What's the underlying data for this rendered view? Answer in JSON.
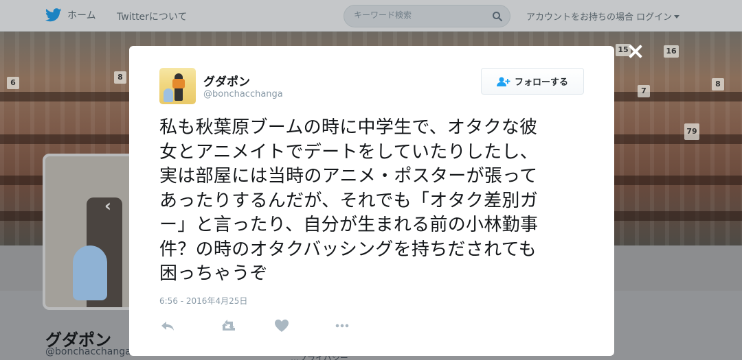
{
  "nav": {
    "home_label": "ホーム",
    "about_label": "Twitterについて",
    "search_placeholder": "キーワード検索",
    "login_label": "アカウントをお持ちの場合 ログイン"
  },
  "tweet": {
    "user_name": "グダポン",
    "user_handle": "@bonchacchanga",
    "follow_label": "フォローする",
    "text_lines": [
      "私も秋葉原ブームの時に中学生で、オタクな彼",
      "女とアニメイトでデートをしていたりしたし、",
      "実は部屋には当時のアニメ・ポスターが張って",
      "あったりするんだが、それでも「オタク差別ガ",
      "ー」と言ったり、自分が生まれる前の小林勤事",
      "件？の時のオタクバッシングを持ちだされても",
      "困っちゃうぞ"
    ],
    "timestamp": "6:56 - 2016年4月25日",
    "actions": [
      "reply-icon",
      "retweet-icon",
      "like-icon",
      "more-icon"
    ]
  },
  "background_profile": {
    "name": "グダポン",
    "handle": "@bonchacchanga",
    "meta_partial": "…プライバシー",
    "signs": [
      "6",
      "8",
      "7",
      "8",
      "15",
      "16",
      "79"
    ]
  },
  "colors": {
    "twitter_blue": "#1da1f2",
    "text_primary": "#14171a",
    "text_secondary": "#8899a6"
  }
}
